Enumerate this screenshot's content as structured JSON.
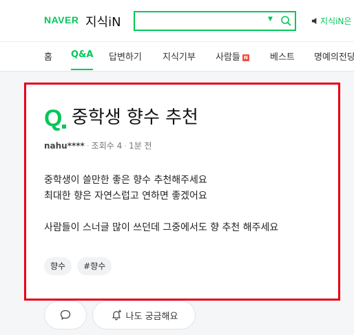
{
  "header": {
    "brand": "NAVER",
    "service": "지식iN",
    "search_placeholder": "",
    "speaker_label": "지식iN은"
  },
  "nav": {
    "items": [
      {
        "label": "홈"
      },
      {
        "label": "Q&A"
      },
      {
        "label": "답변하기"
      },
      {
        "label": "지식기부"
      },
      {
        "label": "사람들",
        "badge": "N"
      },
      {
        "label": "베스트"
      },
      {
        "label": "명예의전당"
      }
    ],
    "active": "Q&A"
  },
  "question": {
    "q_mark": "Q",
    "title": "중학생 향수 추천",
    "author": "nahu****",
    "views_label": "조회수 4",
    "time": "1분 전",
    "body_lines": [
      "중학생이 쓸만한 좋은 향수 추천해주세요",
      "최대한 향은 자연스럽고 연하면 좋겠어요",
      "",
      "사람들이 스너글 많이 쓰던데 그중에서도 향 추천 해주세요"
    ],
    "tags": [
      "향수",
      "#향수"
    ]
  },
  "actions": {
    "curious_label": "나도 궁금해요"
  },
  "colors": {
    "brand_green": "#03c75a",
    "highlight_red": "#e60012",
    "badge_red": "#f0503c"
  },
  "icons": [
    "search-icon",
    "chevron-down-icon",
    "speaker-icon",
    "comment-icon",
    "bell-plus-icon"
  ]
}
